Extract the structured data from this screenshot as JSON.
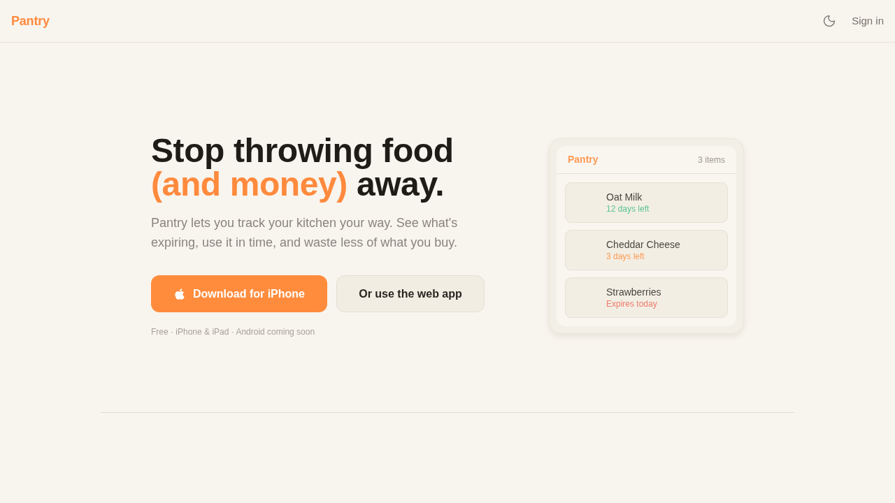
{
  "header": {
    "logo": "Pantry",
    "sign_in": "Sign in"
  },
  "hero": {
    "headline": {
      "line_1": "Stop throwing food",
      "highlight": "(and money)",
      "rest": "away."
    },
    "description": "Pantry lets you track your kitchen your way. See what's expiring, use it in time, and waste less of what you buy.",
    "buttons": [
      {
        "label": "Download for iPhone",
        "kind": "primary"
      },
      {
        "label": "Or use the web app",
        "kind": "secondary"
      }
    ],
    "note": "Free · iPhone & iPad · Android coming soon"
  },
  "preview_card": {
    "title": "Pantry",
    "count": "3 items",
    "items": [
      {
        "name": "Oat Milk",
        "status": "12 days left",
        "color": "#5cc492"
      },
      {
        "name": "Cheddar Cheese",
        "status": "3 days left",
        "color": "#ff9a52"
      },
      {
        "name": "Strawberries",
        "status": "Expires today",
        "color": "#ef7a6a"
      }
    ]
  }
}
